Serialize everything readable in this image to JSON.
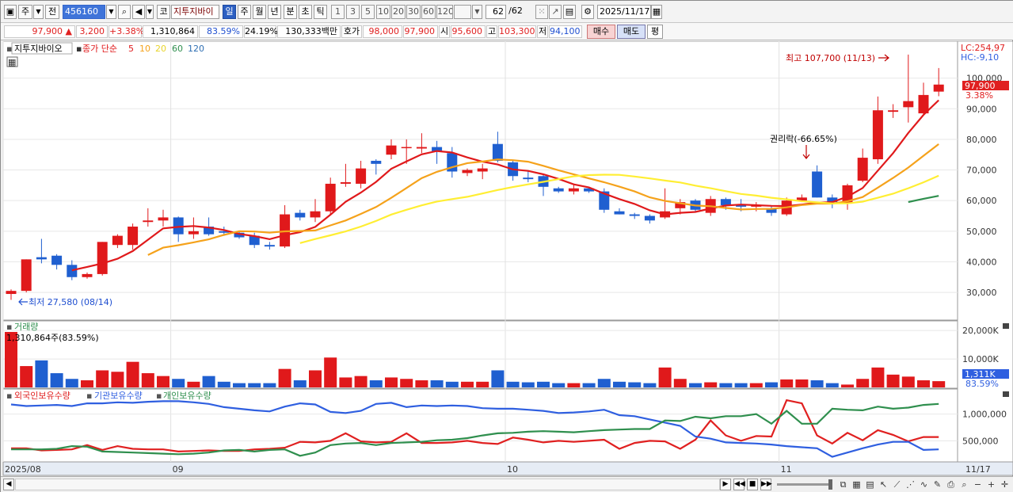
{
  "toolbar": {
    "market_label": "주",
    "prev_label": "전",
    "stock_code": "456160",
    "kospi_label": "코",
    "stock_name": "지투지바이",
    "periods": [
      "일",
      "주",
      "월",
      "년",
      "분",
      "초",
      "틱"
    ],
    "selected_period": "일",
    "intervals": [
      "1",
      "3",
      "5",
      "10",
      "20",
      "30",
      "60",
      "120"
    ],
    "count": "62",
    "total": "/62",
    "date": "2025/11/17"
  },
  "quote": {
    "price": "97,900",
    "change": "3,200",
    "change_pct": "+3.38%",
    "volume": "1,310,864",
    "vol_ratio": "83.59%",
    "turnover": "24.19%",
    "amount": "130,333백만",
    "hoga_label": "호가",
    "ask": "98,000",
    "bid": "97,900",
    "open_label": "시",
    "open": "95,600",
    "high_label": "고",
    "high": "103,300",
    "low_label": "저",
    "low": "94,100",
    "buy_label": "매수",
    "sell_label": "매도",
    "eval_label": "평"
  },
  "price_panel": {
    "title": "지투지바이오",
    "indicator_label": "종가 단순",
    "ma_periods": [
      "5",
      "10",
      "20",
      "60",
      "120"
    ],
    "ma_colors": {
      "5": "#e0191b",
      "10": "#f5a21b",
      "20": "#ffee33",
      "60": "#2f8f4e",
      "120": "#2f6fb3"
    },
    "lc_label": "LC:254,97",
    "hc_label": "HC:-9,10",
    "high_annotation": "최고 107,700 (11/13)",
    "low_annotation": "최저 27,580 (08/14)",
    "rights_annotation": "권리락(-66.65%)",
    "last_price_tag": "97,900",
    "last_pct_tag": "3.38%",
    "y_ticks": [
      "100,000",
      "90,000",
      "80,000",
      "70,000",
      "60,000",
      "50,000",
      "40,000",
      "30,000"
    ]
  },
  "volume_panel": {
    "title": "거래량",
    "value_label": "1,310,864주(83.59%)",
    "y_ticks": [
      "20,000K",
      "10,000K"
    ],
    "last_tag": "1,311K",
    "last_pct_tag": "83.59%"
  },
  "holding_panel": {
    "series": [
      {
        "name": "외국인보유수량",
        "color": "#e02020"
      },
      {
        "name": "기관보유수량",
        "color": "#2f5fe0"
      },
      {
        "name": "개인보유수량",
        "color": "#2f8f4e"
      }
    ],
    "y_ticks": [
      "1,000,000",
      "500,000"
    ]
  },
  "x_axis": {
    "labels": [
      "2025/08",
      "09",
      "10",
      "11"
    ],
    "end_label": "11/17"
  },
  "chart_data": {
    "type": "candlestick",
    "y_range": [
      22000,
      110000
    ],
    "candles": [
      [
        29500,
        31000,
        27580,
        30500
      ],
      [
        30500,
        40800,
        30000,
        40800
      ],
      [
        41500,
        47500,
        39500,
        40800
      ],
      [
        42000,
        42500,
        37500,
        39000
      ],
      [
        39000,
        40500,
        34000,
        35000
      ],
      [
        35000,
        36500,
        34500,
        36000
      ],
      [
        36000,
        46500,
        35500,
        46500
      ],
      [
        45500,
        49000,
        44500,
        48500
      ],
      [
        45500,
        52500,
        44000,
        51500
      ],
      [
        53000,
        57500,
        51500,
        53500
      ],
      [
        53500,
        57000,
        51500,
        54500
      ],
      [
        54500,
        54800,
        46500,
        49000
      ],
      [
        49000,
        54500,
        47500,
        50000
      ],
      [
        51500,
        54500,
        48500,
        49000
      ],
      [
        50000,
        51500,
        48500,
        49500
      ],
      [
        49500,
        50000,
        47500,
        48000
      ],
      [
        48500,
        49500,
        44500,
        45500
      ],
      [
        45500,
        46500,
        44000,
        45000
      ],
      [
        45000,
        58500,
        44500,
        55500
      ],
      [
        56000,
        57000,
        53500,
        54500
      ],
      [
        54500,
        60500,
        53000,
        56500
      ],
      [
        56500,
        67500,
        55500,
        65500
      ],
      [
        65500,
        72000,
        64500,
        66000
      ],
      [
        65500,
        73000,
        64000,
        70500
      ],
      [
        73000,
        73500,
        68500,
        72000
      ],
      [
        75000,
        80000,
        73500,
        78000
      ],
      [
        77500,
        80000,
        72000,
        77500
      ],
      [
        77000,
        82000,
        75500,
        77500
      ],
      [
        77500,
        79500,
        72000,
        76000
      ],
      [
        75500,
        77500,
        67500,
        69500
      ],
      [
        69000,
        70500,
        68000,
        70000
      ],
      [
        69500,
        72000,
        67000,
        70500
      ],
      [
        78500,
        82500,
        72500,
        73000
      ],
      [
        72500,
        73000,
        66500,
        68000
      ],
      [
        67500,
        69500,
        66000,
        67000
      ],
      [
        68000,
        68500,
        61500,
        64500
      ],
      [
        64000,
        64500,
        62500,
        63000
      ],
      [
        63000,
        65500,
        62000,
        64000
      ],
      [
        64000,
        64500,
        62500,
        63000
      ],
      [
        63000,
        64000,
        56000,
        57000
      ],
      [
        56500,
        57500,
        55500,
        55500
      ],
      [
        55500,
        56000,
        54000,
        55000
      ],
      [
        55000,
        55500,
        52500,
        53500
      ],
      [
        54500,
        64000,
        54000,
        56500
      ],
      [
        57500,
        60500,
        55500,
        59500
      ],
      [
        60000,
        60500,
        56500,
        57000
      ],
      [
        56000,
        61500,
        55000,
        60500
      ],
      [
        60500,
        61000,
        57000,
        58500
      ],
      [
        58500,
        60500,
        56500,
        58000
      ],
      [
        58000,
        59500,
        56500,
        58500
      ],
      [
        57500,
        58500,
        55000,
        56000
      ],
      [
        55500,
        61000,
        55000,
        60000
      ],
      [
        60000,
        62000,
        59500,
        61000
      ],
      [
        69500,
        71500,
        61000,
        61000
      ],
      [
        61000,
        62000,
        57500,
        59500
      ],
      [
        59000,
        65500,
        57000,
        65000
      ],
      [
        66500,
        77000,
        66000,
        74000
      ],
      [
        73500,
        94000,
        72000,
        89500
      ],
      [
        89000,
        91500,
        87000,
        89500
      ],
      [
        90500,
        107700,
        85500,
        92500
      ],
      [
        88500,
        98500,
        88000,
        94500
      ],
      [
        95600,
        103300,
        94100,
        97900
      ]
    ],
    "volume": [
      19.5,
      7.5,
      9.5,
      5,
      3,
      2.5,
      6,
      5.5,
      9,
      5,
      4,
      3,
      2,
      4,
      2,
      1.5,
      1.5,
      1.5,
      6.5,
      2.5,
      6,
      10.5,
      3.5,
      4,
      2.5,
      3.5,
      3,
      2.5,
      2.5,
      2,
      2,
      2,
      6,
      2,
      1.8,
      2,
      1.5,
      1.5,
      1.5,
      3,
      2,
      1.8,
      1.5,
      7,
      3,
      1.5,
      1.8,
      1.5,
      1.5,
      1.5,
      1.8,
      2.8,
      2.8,
      2.5,
      1.5,
      1,
      3,
      7,
      4.5,
      3.8,
      2.5,
      2.2
    ],
    "foreign_holding": [
      360000,
      360000,
      320000,
      330000,
      340000,
      420000,
      330000,
      400000,
      350000,
      340000,
      340000,
      300000,
      310000,
      320000,
      310000,
      310000,
      340000,
      350000,
      370000,
      480000,
      470000,
      500000,
      640000,
      490000,
      470000,
      480000,
      640000,
      460000,
      460000,
      470000,
      500000,
      460000,
      440000,
      560000,
      520000,
      470000,
      500000,
      480000,
      500000,
      520000,
      350000,
      460000,
      500000,
      490000,
      350000,
      520000,
      880000,
      600000,
      500000,
      590000,
      580000,
      1260000,
      1200000,
      600000,
      450000,
      650000,
      510000,
      700000,
      610000,
      490000,
      570000,
      570000
    ],
    "institution_holding": [
      1180000,
      1150000,
      1160000,
      1170000,
      1150000,
      1200000,
      1200000,
      1220000,
      1210000,
      1230000,
      1240000,
      1240000,
      1220000,
      1190000,
      1130000,
      1100000,
      1070000,
      1050000,
      1140000,
      1200000,
      1180000,
      1040000,
      1020000,
      1060000,
      1190000,
      1210000,
      1130000,
      1160000,
      1150000,
      1160000,
      1150000,
      1110000,
      1100000,
      1100000,
      1080000,
      1060000,
      1020000,
      1030000,
      1050000,
      1080000,
      980000,
      960000,
      900000,
      840000,
      780000,
      580000,
      540000,
      470000,
      460000,
      450000,
      430000,
      400000,
      380000,
      360000,
      200000,
      280000,
      360000,
      430000,
      480000,
      480000,
      330000,
      340000
    ],
    "individual_holding": [
      340000,
      340000,
      340000,
      350000,
      400000,
      390000,
      300000,
      290000,
      280000,
      270000,
      260000,
      250000,
      260000,
      280000,
      320000,
      330000,
      300000,
      330000,
      340000,
      220000,
      280000,
      420000,
      450000,
      460000,
      420000,
      460000,
      470000,
      480000,
      510000,
      520000,
      550000,
      600000,
      640000,
      650000,
      670000,
      680000,
      670000,
      660000,
      680000,
      700000,
      710000,
      720000,
      720000,
      880000,
      870000,
      950000,
      920000,
      960000,
      960000,
      1000000,
      820000,
      1060000,
      820000,
      820000,
      1100000,
      1080000,
      1070000,
      1140000,
      1100000,
      1120000,
      1170000,
      1190000
    ]
  }
}
